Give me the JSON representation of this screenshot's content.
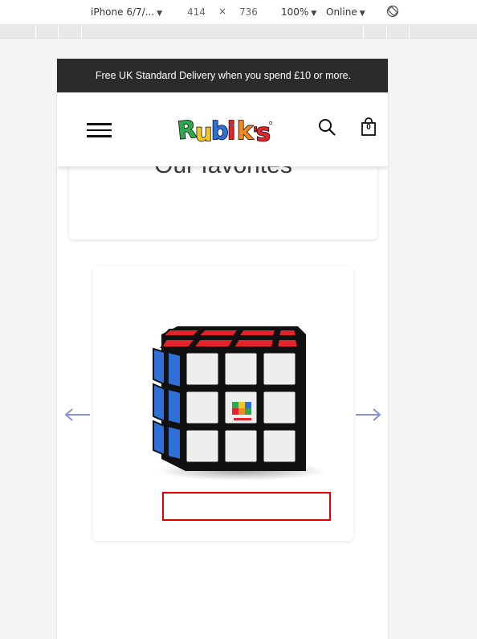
{
  "devtools": {
    "device": "iPhone 6/7/...",
    "width": "414",
    "times": "×",
    "height": "736",
    "zoom": "100%",
    "network": "Online",
    "caret": "▼"
  },
  "promo": {
    "text": "Free UK Standard Delivery when you spend £10 or more."
  },
  "header": {
    "logo_text": "Rubik's",
    "cart_count": "0"
  },
  "favorites": {
    "title": "Our favorites"
  },
  "carousel": {
    "product_name": ""
  },
  "icons": {
    "menu": "hamburger-menu-icon",
    "search": "search-icon",
    "cart": "shopping-bag-icon",
    "prev": "arrow-left-icon",
    "next": "arrow-right-icon",
    "rotate": "rotate-icon"
  },
  "colors": {
    "promo_bg": "#2b2b2b",
    "arrow": "#8a8fd6",
    "highlight": "#e00000",
    "cube_red": "#e3242b",
    "cube_blue": "#2e6fd8"
  }
}
